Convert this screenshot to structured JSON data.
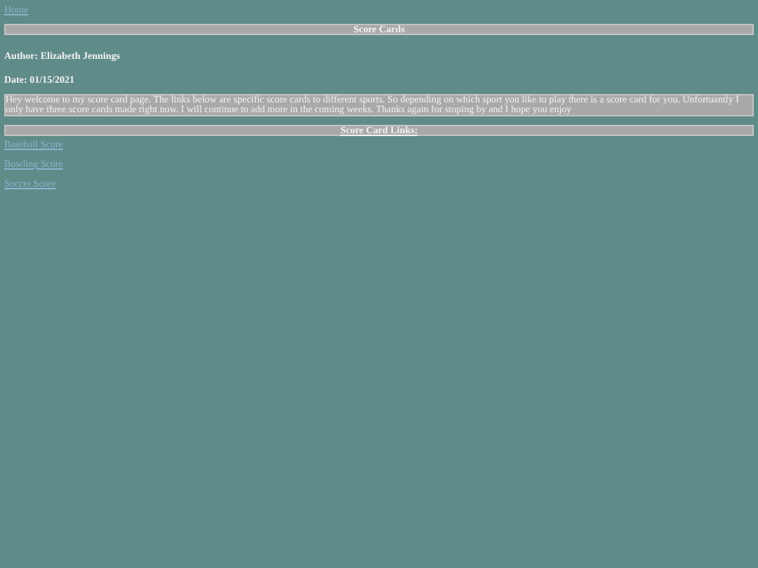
{
  "nav_link": "Home",
  "title": "Score Cards",
  "author": "Author: Elizabeth Jennings",
  "date": "Date: 01/15/2021",
  "intro": "Hey welcome to my score card page. The links below are specific score cards to different sports. So depending on which sport you like to play there is a score card for you. Unfortuantly I only have three score cards made right now. I will continue to add more in the coming weeks. Thanks again for stoping by and I hope you enjoy",
  "links_heading": "Score Card Links:",
  "links": [
    "Baseball Score",
    "Bowling Score",
    "Soccer Score"
  ]
}
